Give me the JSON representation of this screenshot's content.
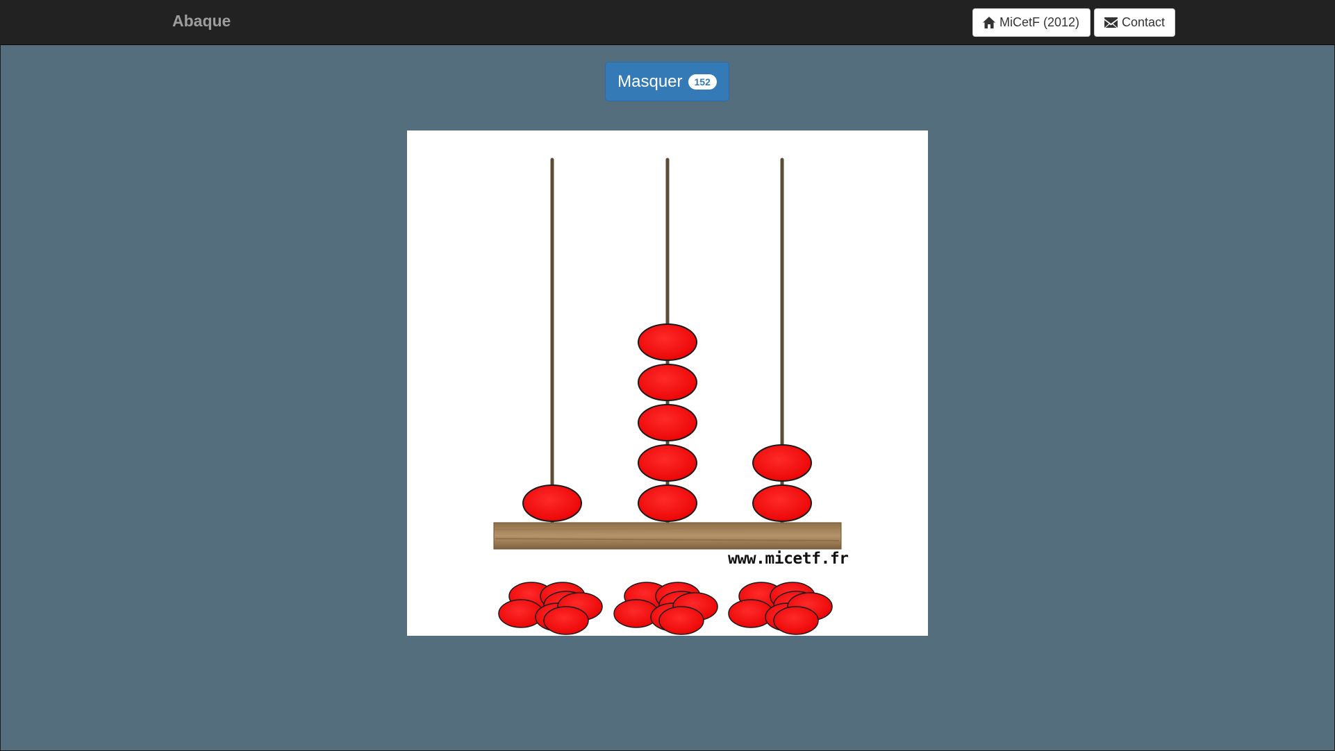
{
  "navbar": {
    "brand": "Abaque",
    "home_button": {
      "label": "MiCetF (2012)",
      "icon": "home-icon"
    },
    "contact_button": {
      "label": "Contact",
      "icon": "envelope-icon"
    }
  },
  "main": {
    "toggle_button": {
      "label": "Masquer",
      "badge": "152"
    }
  },
  "abacus": {
    "rods": [
      {
        "place": "hundreds",
        "beads": 1
      },
      {
        "place": "tens",
        "beads": 5
      },
      {
        "place": "units",
        "beads": 2
      }
    ],
    "spare_piles": 3,
    "watermark": "www.micetf.fr",
    "colors": {
      "bead": "#ff0000",
      "bead_outline": "#1a1a1a",
      "rod": "#5b4e36",
      "base": "#a8865a"
    }
  },
  "theme": {
    "background": "#546e7d",
    "navbar": "#222222",
    "primary": "#337ab7"
  }
}
